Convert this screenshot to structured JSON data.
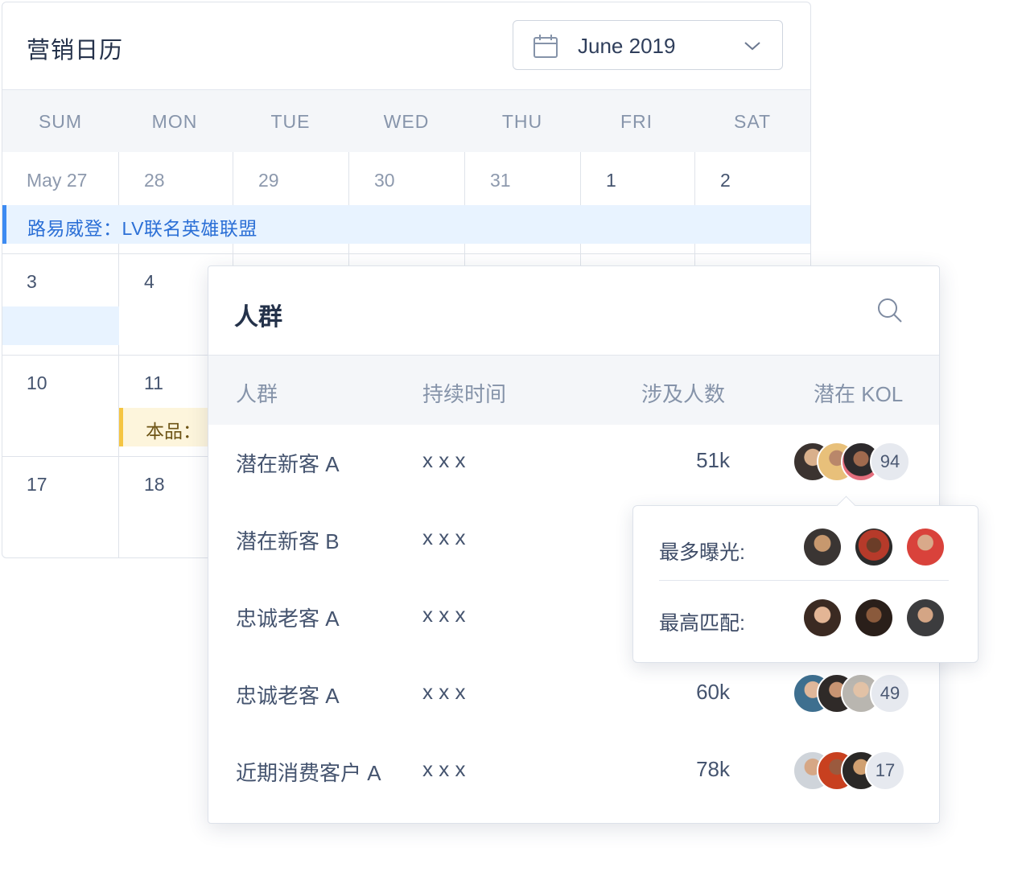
{
  "calendar": {
    "title": "营销日历",
    "month_picker": {
      "value": "June 2019",
      "icon": "calendar-icon",
      "chevron": "chevron-down-icon"
    },
    "weekdays": [
      "SUM",
      "MON",
      "TUE",
      "WED",
      "THU",
      "FRI",
      "SAT"
    ],
    "weeks": [
      [
        "May 27",
        "28",
        "29",
        "30",
        "31",
        "1",
        "2"
      ],
      [
        "3",
        "4"
      ],
      [
        "10",
        "11"
      ],
      [
        "17",
        "18"
      ]
    ],
    "events": {
      "lv": "路易威登：LV联名英雄联盟",
      "product": "本品："
    },
    "colors": {
      "event_blue": "#e8f3ff",
      "event_blue_accent": "#3d8bf2",
      "event_yellow": "#fdf5dc",
      "event_yellow_accent": "#f5c542"
    }
  },
  "panel": {
    "title": "人群",
    "search_icon": "search-icon",
    "columns": [
      "人群",
      "持续时间",
      "涉及人数",
      "潜在 KOL"
    ],
    "rows": [
      {
        "name": "潜在新客 A",
        "duration": "x x x",
        "count": "51k",
        "kol_more": "94"
      },
      {
        "name": "潜在新客 B",
        "duration": "x x x",
        "count": "",
        "kol_more": ""
      },
      {
        "name": "忠诚老客 A",
        "duration": "x x x",
        "count": "",
        "kol_more": ""
      },
      {
        "name": "忠诚老客 A",
        "duration": "x x x",
        "count": "60k",
        "kol_more": "49"
      },
      {
        "name": "近期消费客户 A",
        "duration": "x x x",
        "count": "78k",
        "kol_more": "17"
      }
    ]
  },
  "popover": {
    "most_exposure_label": "最多曝光:",
    "best_match_label": "最高匹配:"
  }
}
